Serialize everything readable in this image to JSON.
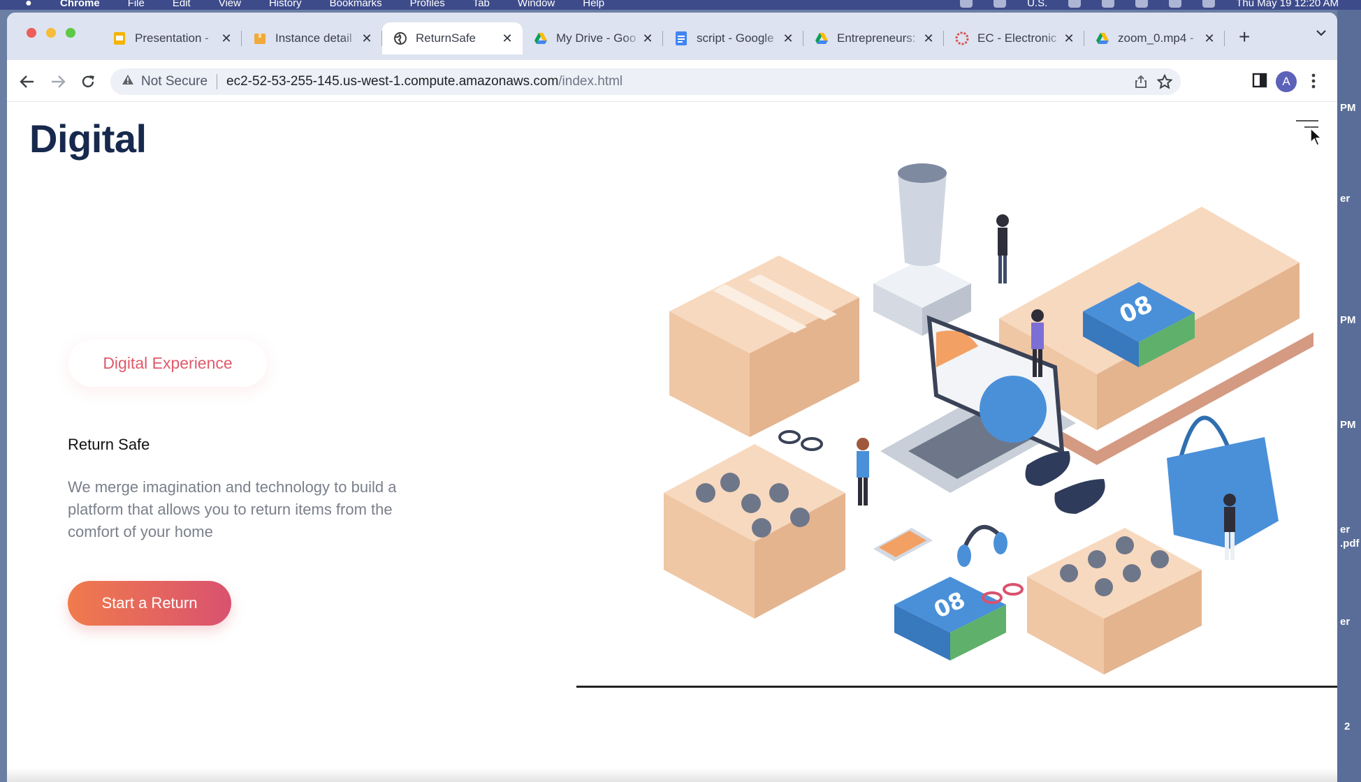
{
  "menubar": {
    "items": [
      "Chrome",
      "File",
      "Edit",
      "View",
      "History",
      "Bookmarks",
      "Profiles",
      "Tab",
      "Window",
      "Help"
    ],
    "input_source": "U.S.",
    "clock": "Thu May 19  12:20 AM"
  },
  "desktop_labels": [
    "PM",
    "er",
    "PM",
    "PM",
    "er",
    ".pdf",
    "er",
    "2"
  ],
  "tabs": [
    {
      "title": "Presentation -",
      "icon": "slides-icon",
      "active": false
    },
    {
      "title": "Instance detail",
      "icon": "aws-box-icon",
      "active": false
    },
    {
      "title": "ReturnSafe",
      "icon": "globe-icon",
      "active": true
    },
    {
      "title": "My Drive - Goo",
      "icon": "drive-icon",
      "active": false
    },
    {
      "title": "script - Google",
      "icon": "docs-icon",
      "active": false
    },
    {
      "title": "Entrepreneurs:",
      "icon": "drive-icon",
      "active": false
    },
    {
      "title": "EC - Electronic",
      "icon": "ec-icon",
      "active": false
    },
    {
      "title": "zoom_0.mp4 -",
      "icon": "drive-icon",
      "active": false
    }
  ],
  "toolbar": {
    "security_label": "Not Secure",
    "url_host": "ec2-52-53-255-145.us-west-1.compute.amazonaws.com",
    "url_path": "/index.html",
    "avatar_initial": "A"
  },
  "page": {
    "brand": "Digital",
    "pill_label": "Digital Experience",
    "hero_title": "Return Safe",
    "hero_description": "We merge imagination and technology to build a platform that allows you to return items from the comfort of your home",
    "cta_label": "Start a Return",
    "illustration_badges": [
      "08",
      "08"
    ]
  },
  "colors": {
    "brand_text": "#17294d",
    "accent_pink": "#e05a6b",
    "cta_gradient_start": "#f07b4c",
    "cta_gradient_end": "#d9526f",
    "box_tan": "#f2c9a7",
    "illustration_blue": "#3b8fd6"
  }
}
